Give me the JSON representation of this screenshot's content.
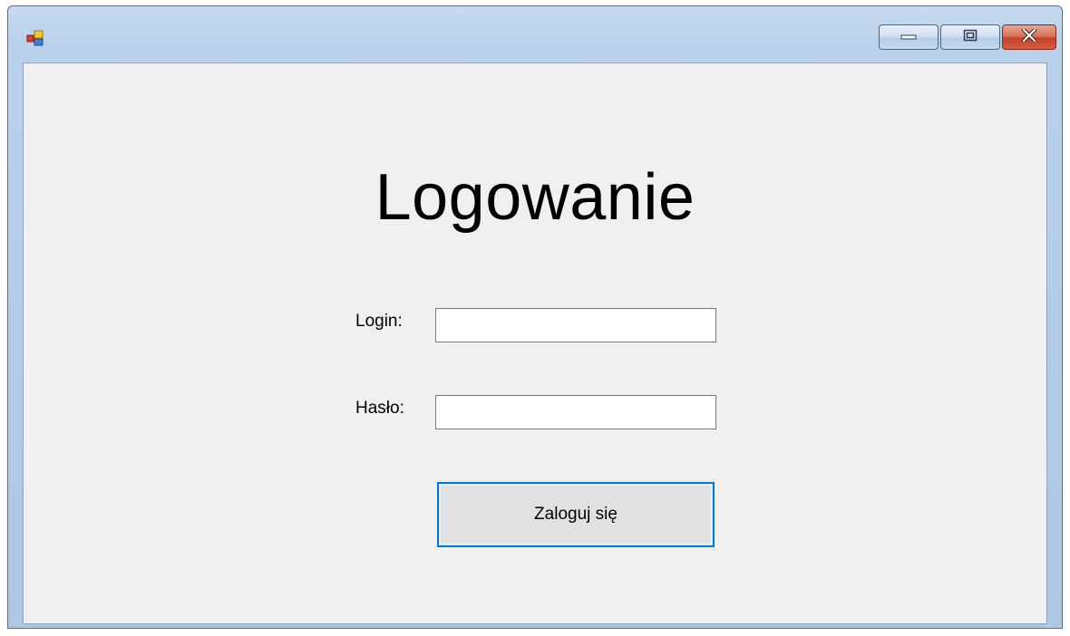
{
  "form": {
    "heading": "Logowanie",
    "login_label": "Login:",
    "login_value": "",
    "password_label": "Hasło:",
    "password_value": "",
    "submit_label": "Zaloguj się"
  },
  "titlebar": {
    "icons": {
      "app": "app-icon",
      "minimize": "minimize-icon",
      "maximize": "maximize-icon",
      "close": "close-icon"
    }
  },
  "colors": {
    "client_background": "#f0f0f0",
    "button_focus_border": "#0078d7",
    "close_button": "#c2432a"
  }
}
